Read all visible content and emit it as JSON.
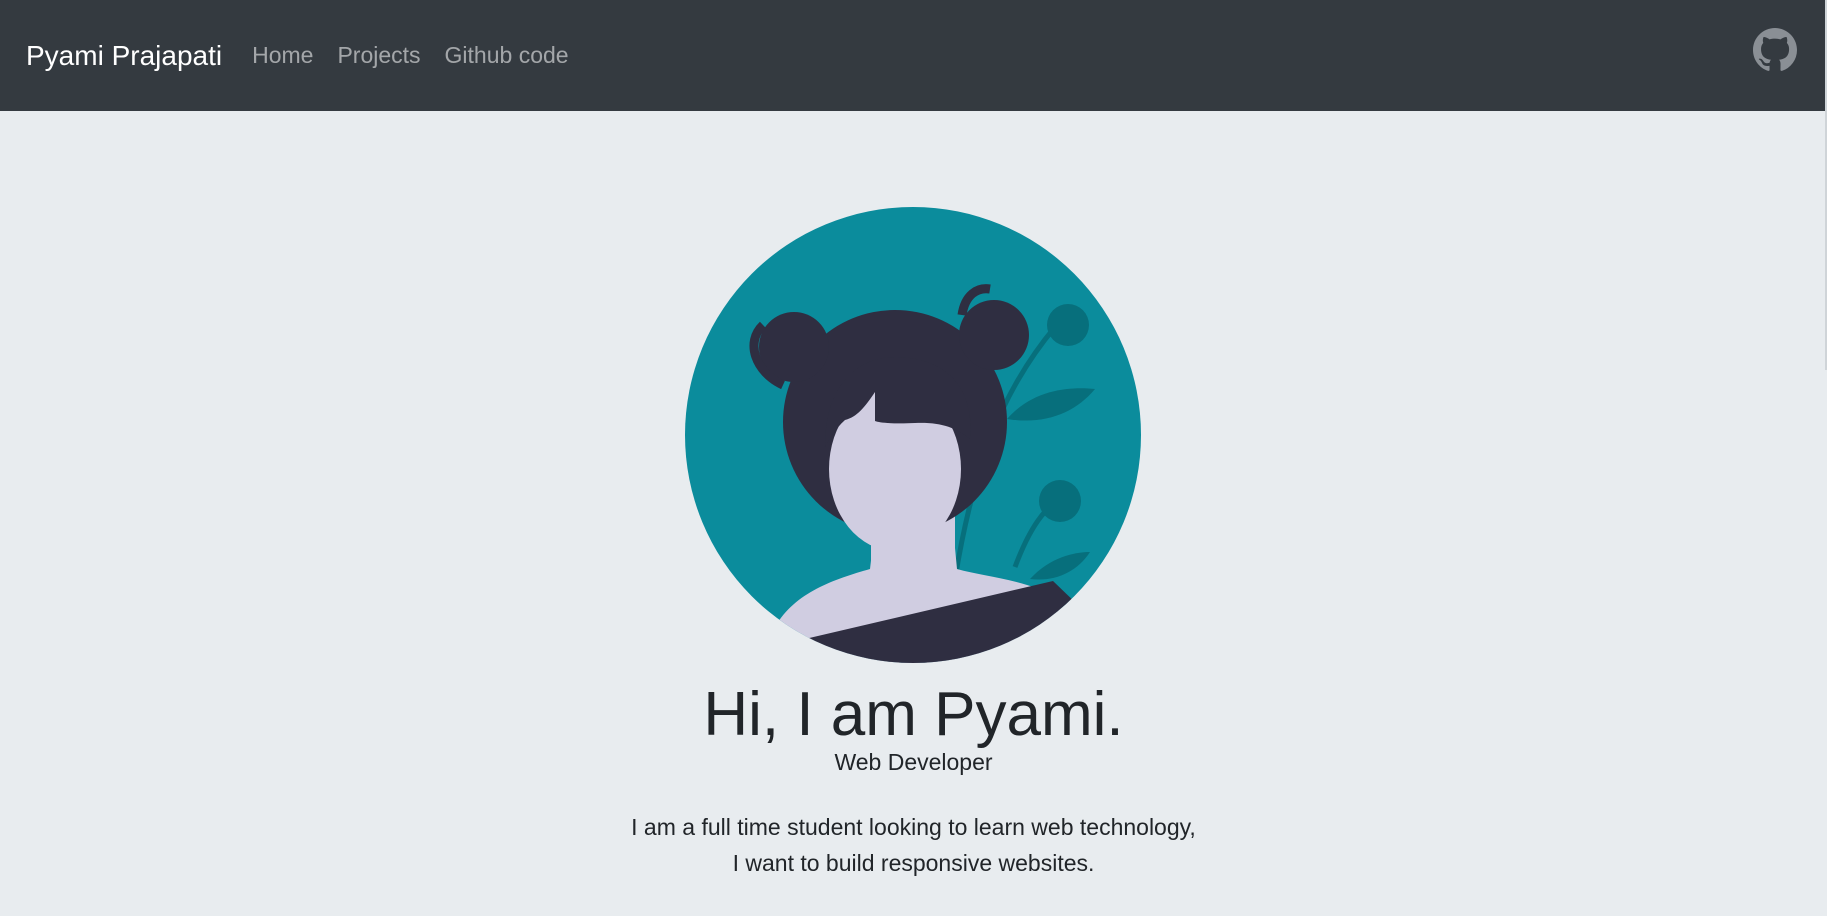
{
  "navbar": {
    "brand": "Pyami Prajapati",
    "links": [
      "Home",
      "Projects",
      "Github code"
    ],
    "github_icon": "github-icon"
  },
  "hero": {
    "avatar": "illustrated-girl-portrait",
    "headline": "Hi, I am Pyami.",
    "role": "Web Developer",
    "bio_line1": "I am a full time student looking to learn web technology,",
    "bio_line2": "I want to build responsive websites."
  },
  "colors": {
    "navbar_bg": "#343a40",
    "page_bg": "#e8ecef",
    "avatar_circle": "#0b8c9c",
    "hair": "#2f2e41",
    "skin": "#d0cde1"
  }
}
